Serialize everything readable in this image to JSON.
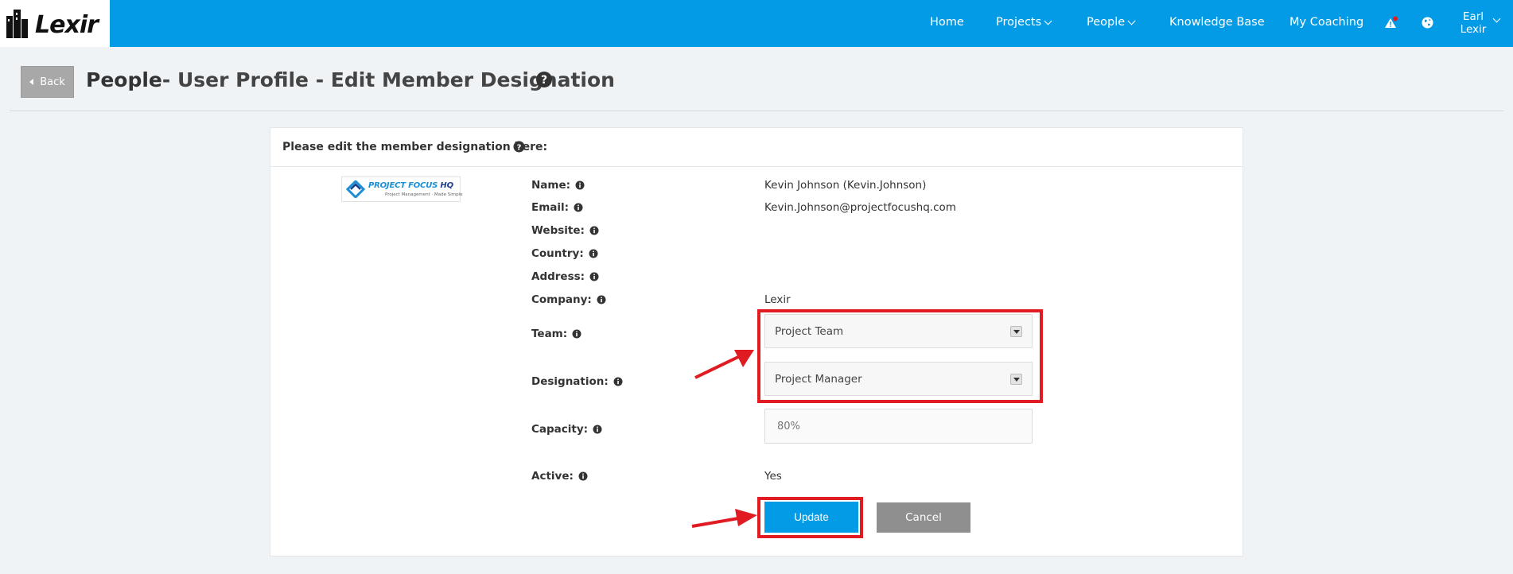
{
  "header": {
    "logo_text": "Lexir",
    "nav": {
      "home": "Home",
      "projects": "Projects",
      "people": "People",
      "knowledge_base": "Knowledge Base",
      "my_coaching": "My Coaching"
    },
    "user_first": "Earl",
    "user_last": "Lexir",
    "alert_dot_color": "#e01b22",
    "accent": "#039be5"
  },
  "page": {
    "back_label": "Back",
    "title_bold": "People",
    "title_rest": "- User Profile - Edit Member Designation"
  },
  "panel": {
    "heading": "Please edit the member designation here:",
    "company_logo": {
      "title": "PROJECT FOCUS",
      "title_suffix": "HQ",
      "tagline": "Project Management · Made Simple"
    },
    "fields": {
      "name_label": "Name:",
      "name_value": "Kevin Johnson (Kevin.Johnson)",
      "email_label": "Email:",
      "email_value": "Kevin.Johnson@projectfocushq.com",
      "website_label": "Website:",
      "country_label": "Country:",
      "address_label": "Address:",
      "company_label": "Company:",
      "company_value": "Lexir",
      "team_label": "Team:",
      "team_value": "Project Team",
      "designation_label": "Designation:",
      "designation_value": "Project Manager",
      "capacity_label": "Capacity:",
      "capacity_placeholder": "80%",
      "active_label": "Active:",
      "active_value": "Yes"
    },
    "update_label": "Update",
    "cancel_label": "Cancel"
  },
  "annotation_color": "#e01b22"
}
